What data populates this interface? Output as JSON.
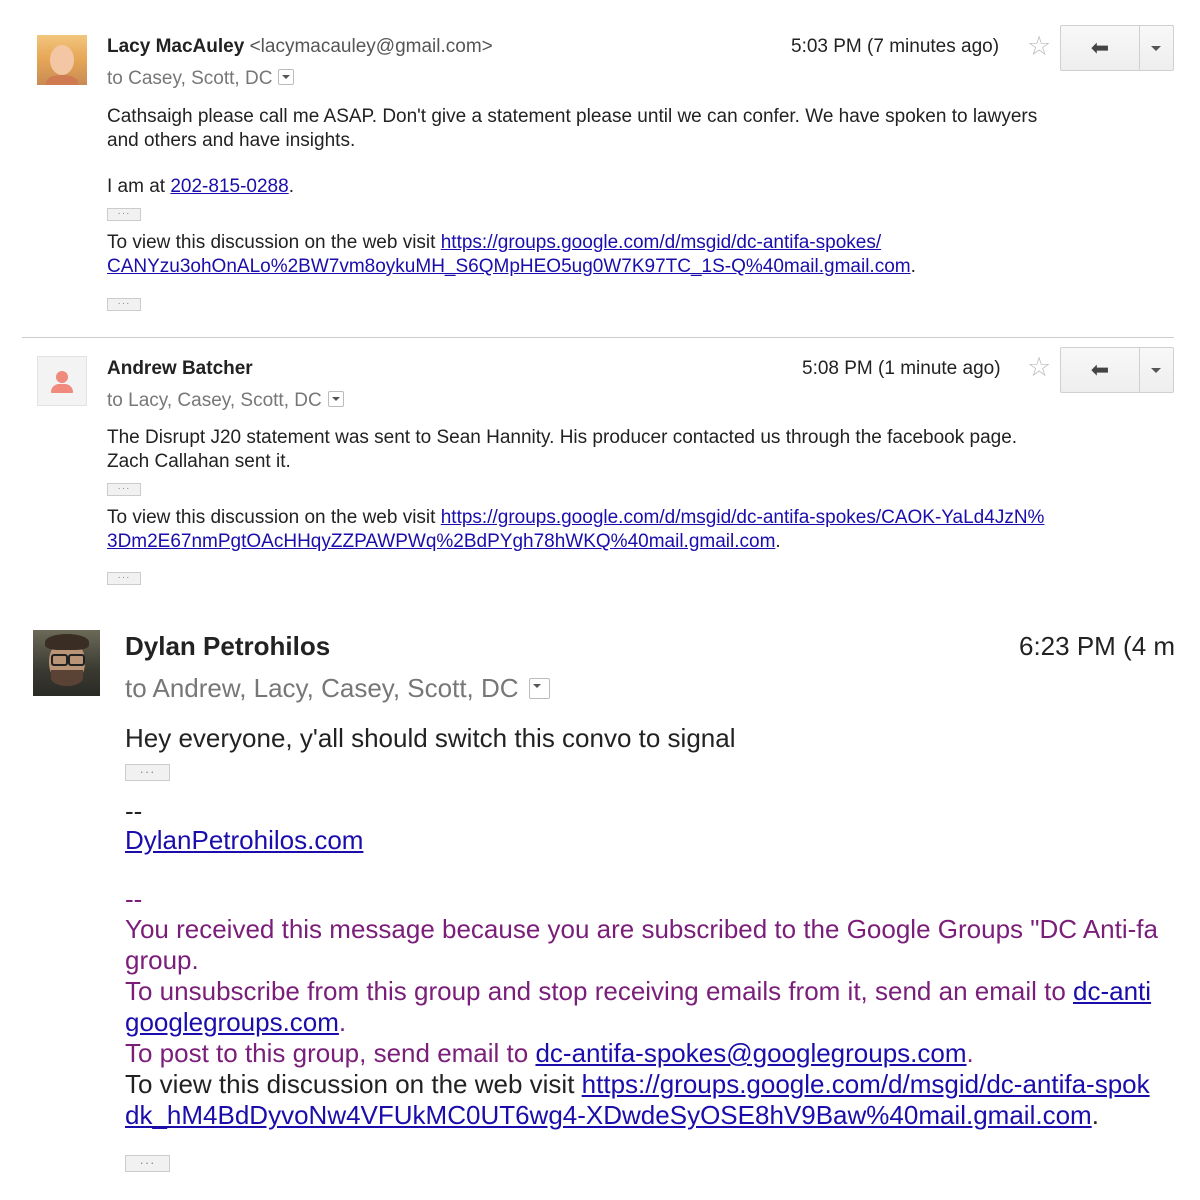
{
  "messages": [
    {
      "sender_name": "Lacy MacAuley",
      "sender_email": "<lacymacauley@gmail.com>",
      "recipients": "to Casey, Scott, DC",
      "time": "5:03 PM (7 minutes ago)",
      "body_line1": "Cathsaigh please call me ASAP. Don't give a statement please until we can confer. We have spoken to lawyers",
      "body_line2": "and others and have insights.",
      "phone_prefix": "I am at ",
      "phone": "202-815-0288",
      "view_prefix": "To view this discussion on the web visit ",
      "link_line1": "https://groups.google.com/d/msgid/dc-antifa-spokes/",
      "link_line2": "CANYzu3ohOnALo%2BW7vm8oykuMH_S6QMpHEO5ug0W7K97TC_1S-Q%40mail.gmail.com"
    },
    {
      "sender_name": "Andrew Batcher",
      "recipients": "to Lacy, Casey, Scott, DC",
      "time": "5:08 PM (1 minute ago)",
      "body_line1": "The Disrupt J20 statement was sent to Sean Hannity.  His producer contacted us through the facebook page.",
      "body_line2": "Zach Callahan sent it.",
      "view_prefix": "To view this discussion on the web visit ",
      "link_line1": "https://groups.google.com/d/msgid/dc-antifa-spokes/CAOK-YaLd4JzN%",
      "link_line2": "3Dm2E67nmPgtOAcHHqyZZPAWPWq%2BdPYgh78hWKQ%40mail.gmail.com"
    },
    {
      "sender_name": "Dylan Petrohilos",
      "recipients": "to Andrew, Lacy, Casey, Scott, DC",
      "time": "6:23 PM (4 m",
      "body_line1": "Hey everyone, y'all should switch this convo to signal",
      "sig_dashes": "--",
      "sig_link": "DylanPetrohilos.com",
      "footer_dashes": "--",
      "footer_line1": "You received this message because you are subscribed to the Google Groups \"DC Anti-fa",
      "footer_line2": "group.",
      "footer_line3": "To unsubscribe from this group and stop receiving emails from it, send an email to ",
      "footer_unsub_link1": "dc-anti",
      "footer_unsub_link2": "googlegroups.com",
      "footer_post_prefix": "To post to this group, send email to ",
      "footer_post_link": "dc-antifa-spokes@googlegroups.com",
      "view_prefix": "To view this discussion on the web visit ",
      "link_line1": "https://groups.google.com/d/msgid/dc-antifa-spok",
      "link_line2": "dk_hM4BdDyvoNw4VFUkMC0UT6wg4-XDwdeSyOSE8hV9Baw%40mail.gmail.com"
    }
  ],
  "punct": {
    "period": "."
  },
  "ui": {
    "dots": "···"
  },
  "colors": {
    "link": "#1a0dab",
    "footer_purple": "#7a1e79",
    "star": "#bbbbbb"
  }
}
